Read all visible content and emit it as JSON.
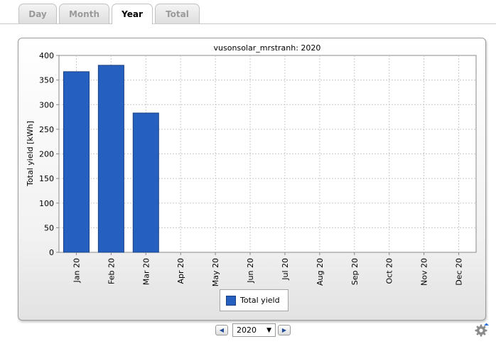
{
  "tabs": [
    {
      "label": "Day",
      "active": false
    },
    {
      "label": "Month",
      "active": false
    },
    {
      "label": "Year",
      "active": true
    },
    {
      "label": "Total",
      "active": false
    }
  ],
  "legend": {
    "label": "Total yield"
  },
  "controls": {
    "prev_icon": "chevron-left-icon",
    "next_icon": "chevron-right-icon",
    "year_value": "2020",
    "settings_icon": "gear-icon"
  },
  "colors": {
    "bar": "#2560c0",
    "bar_border": "#1a3f80",
    "accent": "#1f4d99"
  },
  "chart_data": {
    "type": "bar",
    "title": "vusonsolar_mrstranh: 2020",
    "xlabel": "",
    "ylabel": "Total yield [kWh]",
    "ylim": [
      0,
      400
    ],
    "yticks": [
      0,
      50,
      100,
      150,
      200,
      250,
      300,
      350,
      400
    ],
    "categories": [
      "Jan 20",
      "Feb 20",
      "Mar 20",
      "Apr 20",
      "May 20",
      "Jun 20",
      "Jul 20",
      "Aug 20",
      "Sep 20",
      "Oct 20",
      "Nov 20",
      "Dec 20"
    ],
    "series": [
      {
        "name": "Total yield",
        "values": [
          367,
          380,
          283,
          null,
          null,
          null,
          null,
          null,
          null,
          null,
          null,
          null
        ]
      }
    ],
    "grid": true,
    "legend_position": "bottom"
  }
}
